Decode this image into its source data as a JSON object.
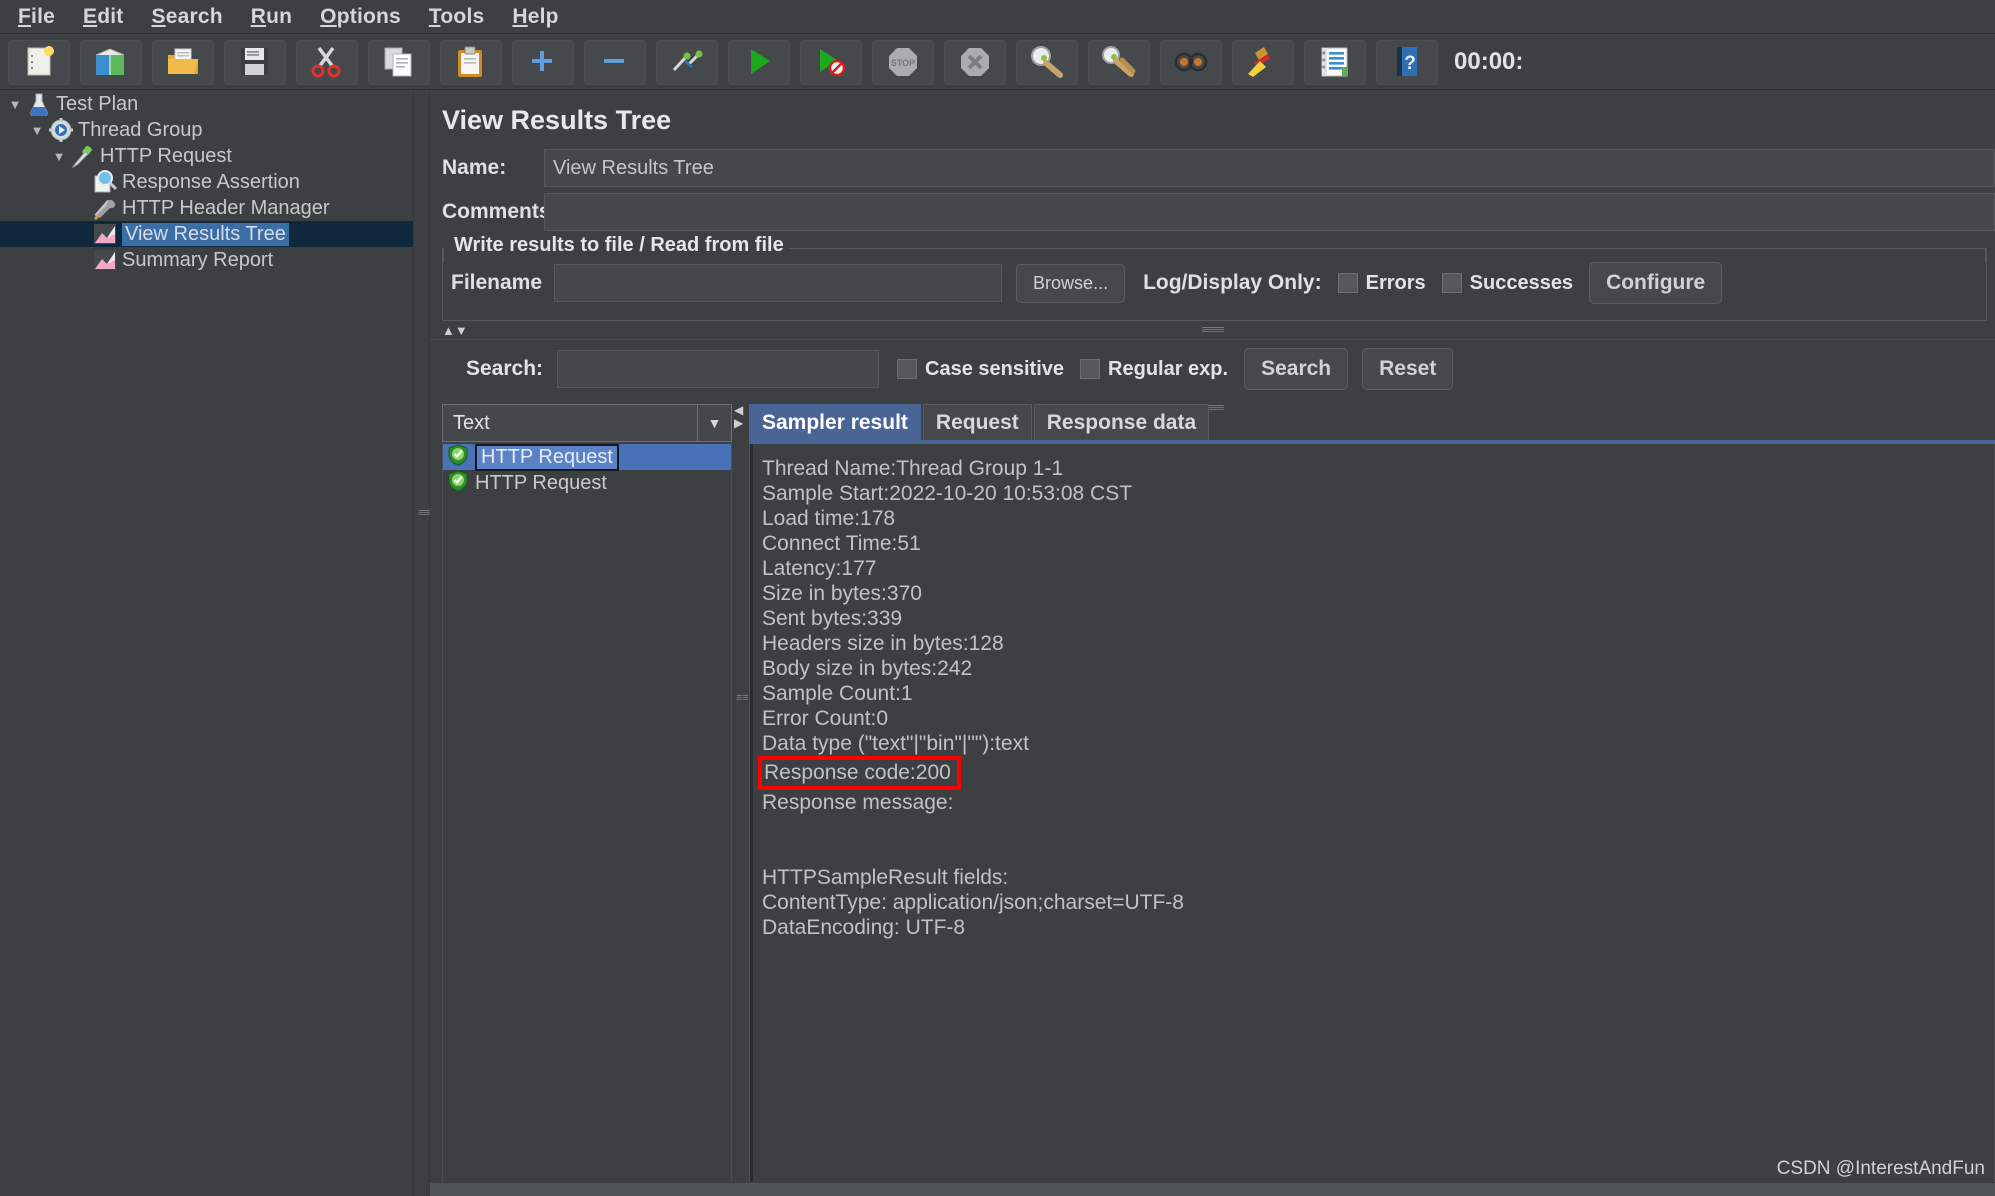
{
  "menubar": {
    "items": [
      {
        "label": "File",
        "mnemonic": "F"
      },
      {
        "label": "Edit",
        "mnemonic": "E"
      },
      {
        "label": "Search",
        "mnemonic": "S"
      },
      {
        "label": "Run",
        "mnemonic": "R"
      },
      {
        "label": "Options",
        "mnemonic": "O"
      },
      {
        "label": "Tools",
        "mnemonic": "T"
      },
      {
        "label": "Help",
        "mnemonic": "H"
      }
    ]
  },
  "toolbar": {
    "buttons": [
      {
        "name": "new-icon"
      },
      {
        "name": "templates-icon"
      },
      {
        "name": "open-icon"
      },
      {
        "name": "save-icon"
      },
      {
        "name": "cut-icon"
      },
      {
        "name": "copy-icon"
      },
      {
        "name": "paste-icon"
      },
      {
        "name": "expand-all-icon"
      },
      {
        "name": "collapse-all-icon"
      },
      {
        "name": "toggle-icon"
      },
      {
        "name": "start-icon"
      },
      {
        "name": "start-no-pause-icon"
      },
      {
        "name": "stop-icon"
      },
      {
        "name": "shutdown-icon"
      },
      {
        "name": "clear-icon"
      },
      {
        "name": "clear-all-icon"
      },
      {
        "name": "search-icon"
      },
      {
        "name": "reset-search-icon"
      },
      {
        "name": "function-helper-icon"
      },
      {
        "name": "help-icon"
      }
    ],
    "timer": "00:00:"
  },
  "tree": {
    "items": [
      {
        "label": "Test Plan",
        "depth": 0,
        "toggle": "down",
        "icon": "test-plan-icon",
        "selected": false
      },
      {
        "label": "Thread Group",
        "depth": 1,
        "toggle": "down",
        "icon": "thread-group-icon",
        "selected": false
      },
      {
        "label": "HTTP Request",
        "depth": 2,
        "toggle": "down",
        "icon": "http-request-icon",
        "selected": false
      },
      {
        "label": "Response Assertion",
        "depth": 3,
        "toggle": "none",
        "icon": "assertion-icon",
        "selected": false
      },
      {
        "label": "HTTP Header Manager",
        "depth": 3,
        "toggle": "none",
        "icon": "header-manager-icon",
        "selected": false
      },
      {
        "label": "View Results Tree",
        "depth": 3,
        "toggle": "none",
        "icon": "view-results-tree-icon",
        "selected": true
      },
      {
        "label": "Summary Report",
        "depth": 3,
        "toggle": "none",
        "icon": "summary-report-icon",
        "selected": false
      }
    ]
  },
  "panel": {
    "title": "View Results Tree",
    "name_label": "Name:",
    "name_value": "View Results Tree",
    "comments_label": "Comments:",
    "comments_value": "",
    "file_group": {
      "legend": "Write results to file / Read from file",
      "filename_label": "Filename",
      "filename_value": "",
      "browse_label": "Browse...",
      "log_display_label": "Log/Display Only:",
      "errors_label": "Errors",
      "errors_checked": false,
      "successes_label": "Successes",
      "successes_checked": false,
      "configure_label": "Configure"
    },
    "search_bar": {
      "label": "Search:",
      "value": "",
      "case_sensitive_label": "Case sensitive",
      "case_sensitive_checked": false,
      "regular_exp_label": "Regular exp.",
      "regular_exp_checked": false,
      "search_button": "Search",
      "reset_button": "Reset"
    }
  },
  "results": {
    "renderer_selected": "Text",
    "entries": [
      {
        "label": "HTTP Request",
        "status": "success",
        "selected": true
      },
      {
        "label": "HTTP Request",
        "status": "success",
        "selected": false
      }
    ],
    "tabs": [
      {
        "label": "Sampler result",
        "active": true
      },
      {
        "label": "Request",
        "active": false
      },
      {
        "label": "Response data",
        "active": false
      }
    ],
    "sampler_result_lines": [
      "Thread Name:Thread Group 1-1",
      "Sample Start:2022-10-20 10:53:08 CST",
      "Load time:178",
      "Connect Time:51",
      "Latency:177",
      "Size in bytes:370",
      "Sent bytes:339",
      "Headers size in bytes:128",
      "Body size in bytes:242",
      "Sample Count:1",
      "Error Count:0",
      "Data type (\"text\"|\"bin\"|\"\"):text",
      "Response code:200",
      "Response message:",
      "",
      "",
      "HTTPSampleResult fields:",
      "ContentType: application/json;charset=UTF-8",
      "DataEncoding: UTF-8"
    ],
    "highlighted_line_index": 12,
    "highlight_color": "#ff0000"
  },
  "watermark": "CSDN @InterestAndFun"
}
